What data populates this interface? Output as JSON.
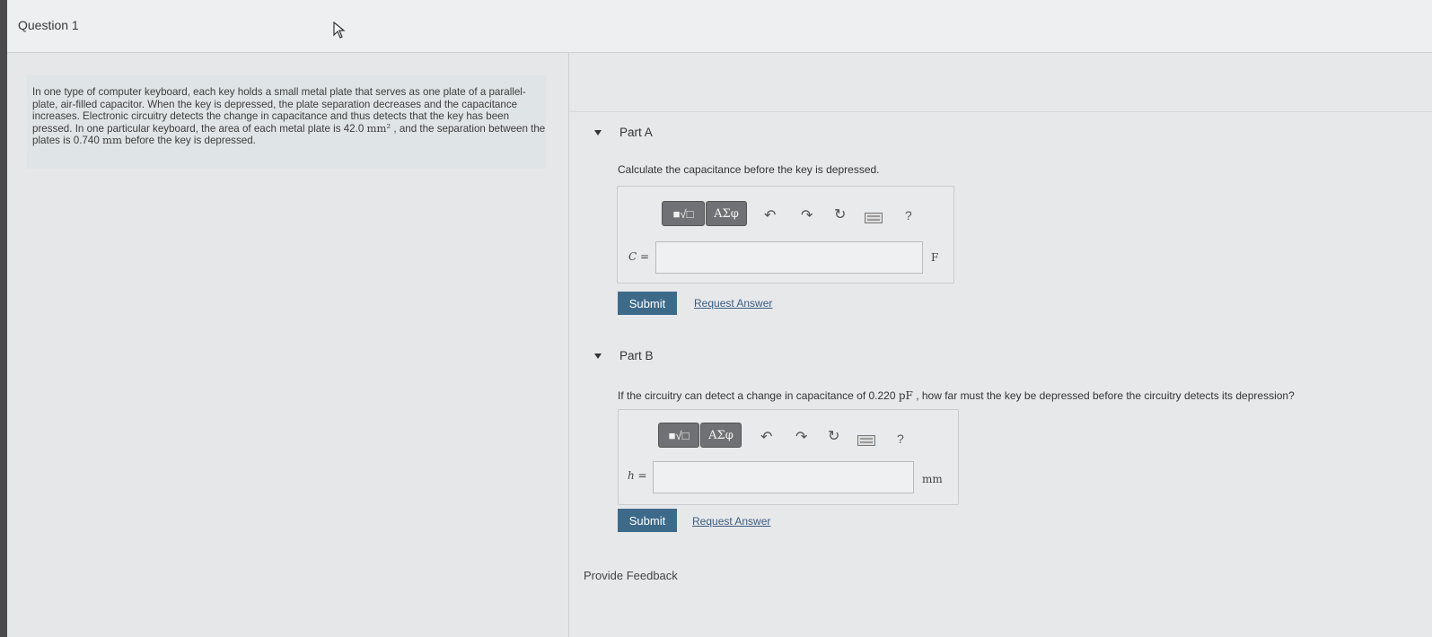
{
  "header": {
    "title": "Question 1"
  },
  "problem": {
    "text_1": "In one type of computer keyboard, each key holds a small metal plate that serves as one plate of a parallel-plate, air-filled capacitor. When the key is depressed, the plate separation decreases and the capacitance increases. Electronic circuitry detects the change in capacitance and thus detects that the key has been pressed. In one particular keyboard, the area of each metal plate is 42.0 ",
    "unit_area": "mm²",
    "text_2": " , and the separation between the plates is 0.740 ",
    "unit_sep": "mm",
    "text_3": " before the key is depressed."
  },
  "toolbar": {
    "template_label": "■√□",
    "symbols_label": "ΑΣφ",
    "undo_icon": "undo-icon",
    "redo_icon": "redo-icon",
    "reset_icon": "reset-icon",
    "keyboard_icon": "keyboard-icon",
    "help_label": "?"
  },
  "partA": {
    "title": "Part A",
    "prompt": "Calculate the capacitance before the key is depressed.",
    "variable": "C =",
    "value": "",
    "unit": "F",
    "submit_label": "Submit",
    "request_label": "Request Answer"
  },
  "partB": {
    "title": "Part B",
    "prompt_1": "If the circuitry can detect a change in capacitance of 0.220 ",
    "prompt_unit": "pF",
    "prompt_2": " , how far must the key be depressed before the circuitry detects its depression?",
    "variable": "h =",
    "value": "",
    "unit": "mm",
    "submit_label": "Submit",
    "request_label": "Request Answer"
  },
  "footer": {
    "feedback_label": "Provide Feedback"
  }
}
